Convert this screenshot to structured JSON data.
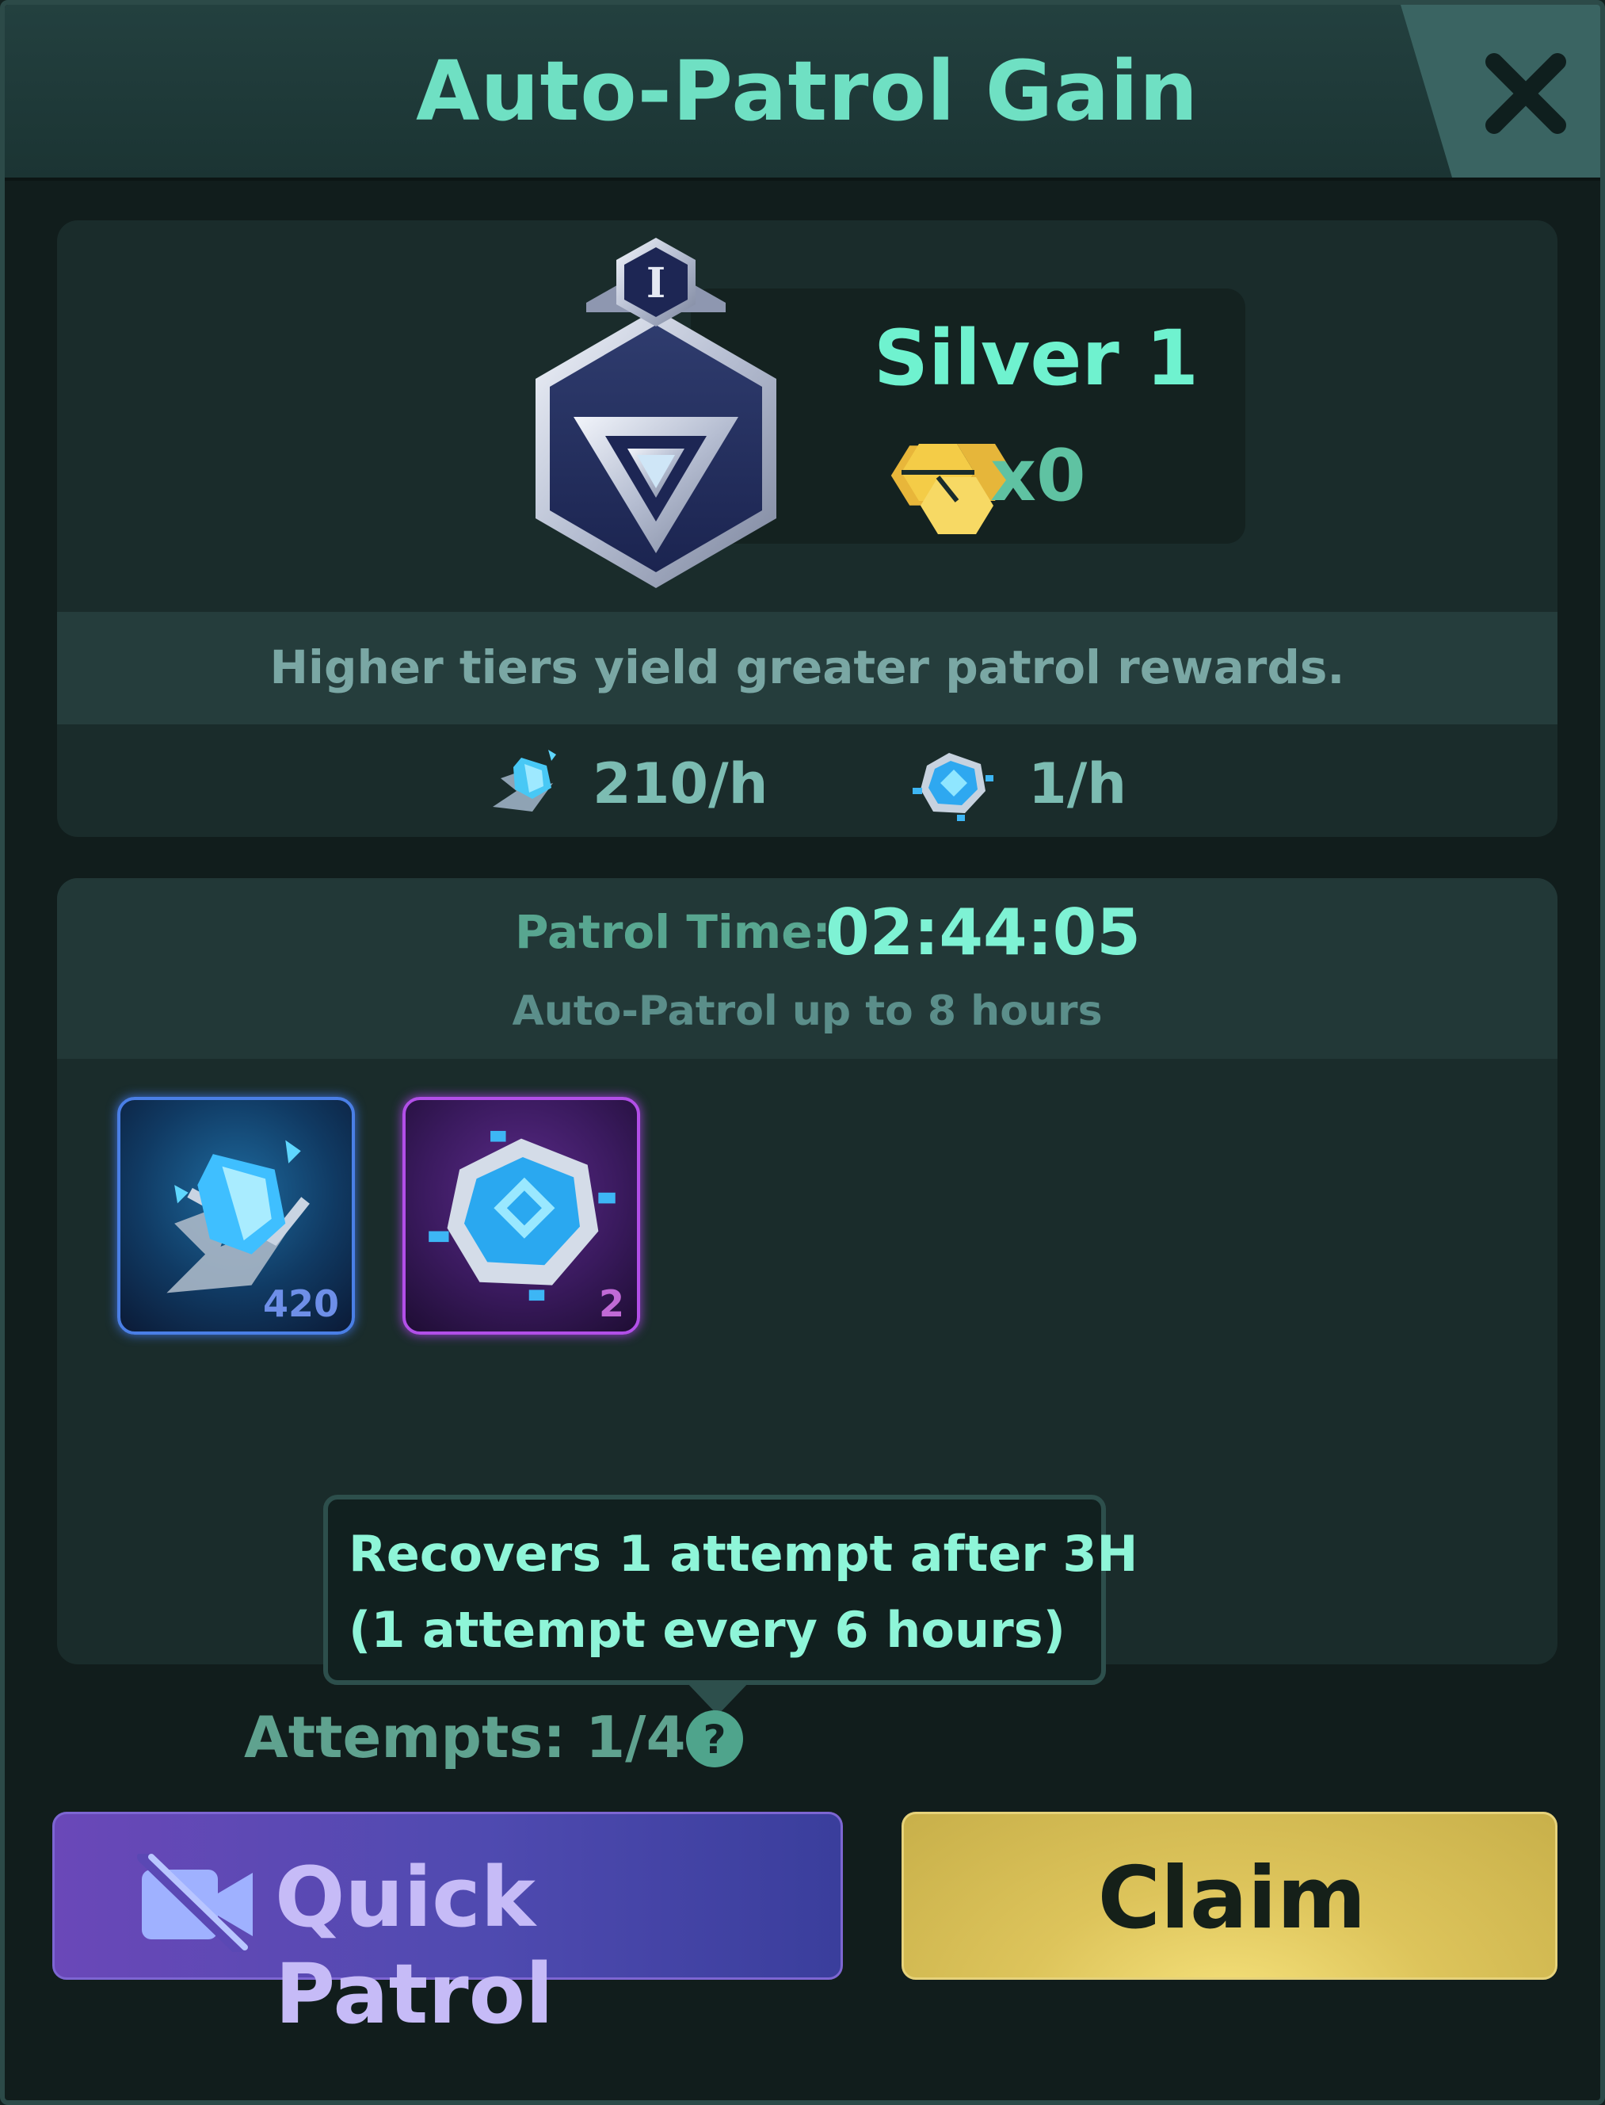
{
  "window": {
    "title": "Auto-Patrol Gain",
    "close_icon": "close-icon"
  },
  "rank": {
    "tier_numeral": "I",
    "name": "Silver 1",
    "token_icon": "honeycomb-token-icon",
    "token_count": "x0",
    "badge_icon": "silver-tier-badge-icon"
  },
  "rewards_hint": "Higher tiers yield greater patrol rewards.",
  "rates": [
    {
      "icon": "crystal-shard-icon",
      "text": "210/h"
    },
    {
      "icon": "chip-core-icon",
      "text": "1/h"
    }
  ],
  "patrol": {
    "time_label": "Patrol Time:",
    "time_value": "02:44:05",
    "limit_note": "Auto-Patrol up to 8 hours"
  },
  "items": [
    {
      "icon": "crystal-shard-icon",
      "count": "420",
      "rarity": "blue"
    },
    {
      "icon": "chip-core-icon",
      "count": "2",
      "rarity": "purple"
    }
  ],
  "tooltip": {
    "line1": "Recovers 1 attempt after 3H",
    "line2": "(1 attempt every 6 hours)"
  },
  "attempts": {
    "label": "Attempts: 1/4",
    "help_icon": "question-icon"
  },
  "buttons": {
    "quick_patrol": "Quick Patrol",
    "quick_patrol_icon": "no-video-icon",
    "claim": "Claim"
  },
  "colors": {
    "accent": "#6fe0c3",
    "panel": "#1a2c2b",
    "quick_button": "#5a48b4",
    "claim_button": "#ddc45b"
  }
}
